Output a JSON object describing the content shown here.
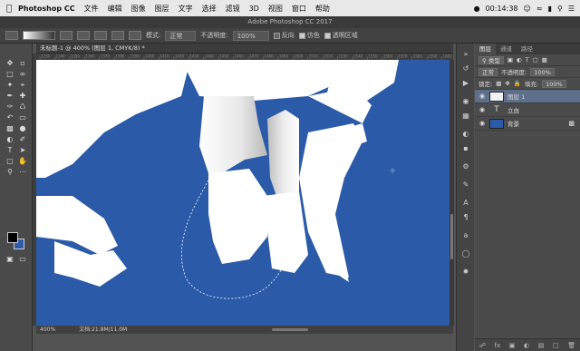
{
  "menubar": {
    "app": "Photoshop CC",
    "items": [
      "文件",
      "编辑",
      "图像",
      "图层",
      "文字",
      "选择",
      "滤镜",
      "3D",
      "视图",
      "窗口",
      "帮助"
    ],
    "clock": "00:14:38"
  },
  "window_title": "Adobe Photoshop CC 2017",
  "options": {
    "mode_label": "模式:",
    "mode_value": "正常",
    "opacity_label": "不透明度:",
    "opacity_value": "100%",
    "reverse": "反向",
    "dither": "仿色",
    "transparency": "透明区域"
  },
  "document_tab": "未标题-1 @ 400% (图层 1, CMYK/8) *",
  "ruler_ticks": [
    "1330",
    "1340",
    "1350",
    "1360",
    "1370",
    "1380",
    "1390",
    "1400",
    "1410",
    "1420",
    "1430",
    "1440",
    "1450",
    "1460",
    "1470",
    "1480",
    "1490",
    "1500",
    "1510",
    "1520",
    "1530",
    "1540",
    "1550",
    "1560",
    "1570",
    "1580",
    "1590",
    "1600"
  ],
  "status": {
    "zoom": "400%",
    "doc_info": "文档:21.8M/11.0M"
  },
  "colors": {
    "canvas_blue": "#2a5aa8",
    "white_shape": "#ffffff",
    "layer_selected": "#5d6f8a"
  },
  "layers_panel": {
    "tabs": [
      "图层",
      "通道",
      "路径"
    ],
    "filter_label": "类型",
    "blend_mode": "正常",
    "opacity_label": "不透明度:",
    "opacity_value": "100%",
    "lock_label": "锁定:",
    "fill_label": "填充:",
    "fill_value": "100%",
    "layers": [
      {
        "name": "图层 1",
        "kind": "pixel",
        "selected": true
      },
      {
        "name": "立血",
        "kind": "text",
        "selected": false
      },
      {
        "name": "背景",
        "kind": "background",
        "selected": false
      }
    ]
  }
}
